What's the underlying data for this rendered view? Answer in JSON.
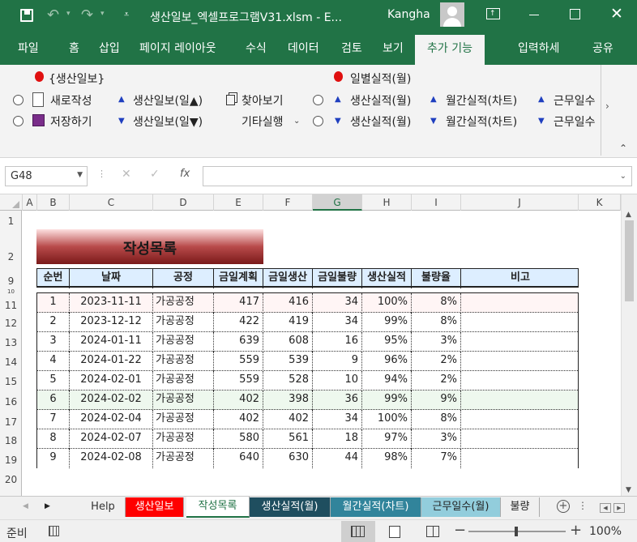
{
  "title_bar": {
    "file_title": "생산일보_엑셀프로그램V31.xlsm - E...",
    "user": "Kangha"
  },
  "ribbon_tabs": [
    "파일",
    "홈",
    "삽입",
    "페이지 레이아웃",
    "수식",
    "데이터",
    "검토",
    "보기",
    "추가 기능",
    "입력하세",
    "공유"
  ],
  "ribbon": {
    "group1_title": "{생산일보}",
    "new_doc": "새로작성",
    "save": "저장하기",
    "daily_up": "생산일보(일▲)",
    "daily_down": "생산일보(일▼)",
    "find": "찾아보기",
    "other": "기타실행",
    "group2_title": "일별실적(월)",
    "perf_up": "생산실적(월)",
    "perf_down": "생산실적(월)",
    "monthly_up": "월간실적(차트)",
    "monthly_down": "월간실적(차트)",
    "work_up": "근무일수",
    "work_down": "근무일수"
  },
  "formula_bar": {
    "name_box": "G48",
    "fx": "fx",
    "formula": ""
  },
  "columns": [
    "A",
    "B",
    "C",
    "D",
    "E",
    "F",
    "G",
    "H",
    "I",
    "J",
    "K"
  ],
  "rows": [
    "1",
    "2",
    "9",
    "10",
    "11",
    "12",
    "13",
    "14",
    "15",
    "16",
    "17",
    "18",
    "19",
    "20"
  ],
  "sheet": {
    "heading": "작성목록",
    "headers": [
      "순번",
      "날짜",
      "공정",
      "금일계획",
      "금일생산",
      "금일불량",
      "생산실적",
      "불량율",
      "비고"
    ],
    "data": [
      [
        "1",
        "2023-11-11",
        "가공공정",
        "417",
        "416",
        "34",
        "100%",
        "8%",
        ""
      ],
      [
        "2",
        "2023-12-12",
        "가공공정",
        "422",
        "419",
        "34",
        "99%",
        "8%",
        ""
      ],
      [
        "3",
        "2024-01-11",
        "가공공정",
        "639",
        "608",
        "16",
        "95%",
        "3%",
        ""
      ],
      [
        "4",
        "2024-01-22",
        "가공공정",
        "559",
        "539",
        "9",
        "96%",
        "2%",
        ""
      ],
      [
        "5",
        "2024-02-01",
        "가공공정",
        "559",
        "528",
        "10",
        "94%",
        "2%",
        ""
      ],
      [
        "6",
        "2024-02-02",
        "가공공정",
        "402",
        "398",
        "36",
        "99%",
        "9%",
        ""
      ],
      [
        "7",
        "2024-02-04",
        "가공공정",
        "402",
        "402",
        "34",
        "100%",
        "8%",
        ""
      ],
      [
        "8",
        "2024-02-07",
        "가공공정",
        "580",
        "561",
        "18",
        "97%",
        "3%",
        ""
      ],
      [
        "9",
        "2024-02-08",
        "가공공정",
        "640",
        "630",
        "44",
        "98%",
        "7%",
        ""
      ]
    ]
  },
  "sheet_tabs": [
    {
      "label": "Help",
      "bg": "#f0f0f0",
      "fg": "#333"
    },
    {
      "label": "생산일보",
      "bg": "#ff0000",
      "fg": "#ffffff"
    },
    {
      "label": "작성목록",
      "bg": "#ffffff",
      "fg": "#217346"
    },
    {
      "label": "생산실적(월)",
      "bg": "#1f4e5f",
      "fg": "#ffffff"
    },
    {
      "label": "월간실적(차트)",
      "bg": "#31849b",
      "fg": "#ffffff"
    },
    {
      "label": "근무일수(월)",
      "bg": "#92cddc",
      "fg": "#222222"
    },
    {
      "label": "불량",
      "bg": "#f0f0f0",
      "fg": "#222222"
    }
  ],
  "status": {
    "ready": "준비",
    "zoom": "100%"
  },
  "colors": {
    "excel_green": "#217346",
    "header_fill": "#ddeeff",
    "highlight_row": "#eef8ee",
    "first_row": "#fff5f5"
  }
}
